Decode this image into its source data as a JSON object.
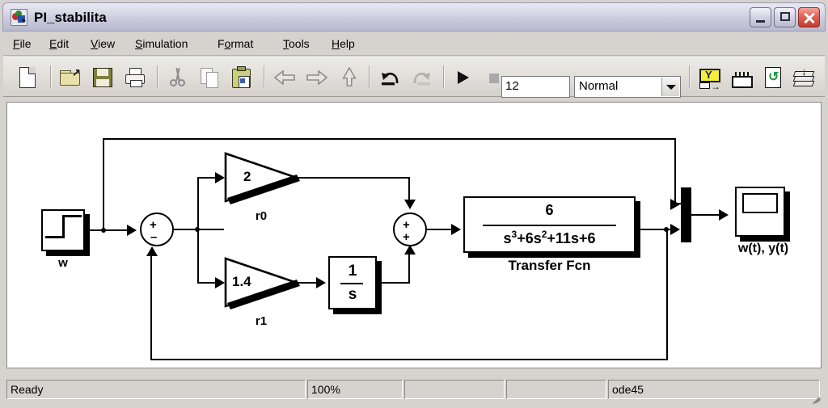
{
  "window": {
    "title": "PI_stabilita",
    "icon": "simulink-icon",
    "controls": {
      "minimize": "minimize-button",
      "maximize": "maximize-button",
      "close": "close-button"
    }
  },
  "menu": {
    "items": [
      {
        "label": "File",
        "accel": "F"
      },
      {
        "label": "Edit",
        "accel": "E"
      },
      {
        "label": "View",
        "accel": "V"
      },
      {
        "label": "Simulation",
        "accel": "S"
      },
      {
        "label": "Format",
        "accel": "o"
      },
      {
        "label": "Tools",
        "accel": "T"
      },
      {
        "label": "Help",
        "accel": "H"
      }
    ]
  },
  "toolbar": {
    "buttons": [
      {
        "name": "new-model-icon",
        "enabled": true
      },
      {
        "name": "open-model-icon",
        "enabled": true
      },
      {
        "name": "save-model-icon",
        "enabled": true
      },
      {
        "name": "print-model-icon",
        "enabled": true
      },
      {
        "name": "cut-icon",
        "enabled": false
      },
      {
        "name": "copy-icon",
        "enabled": false
      },
      {
        "name": "paste-icon",
        "enabled": true
      },
      {
        "name": "back-arrow-icon",
        "enabled": false
      },
      {
        "name": "forward-arrow-icon",
        "enabled": false
      },
      {
        "name": "up-arrow-icon",
        "enabled": false
      },
      {
        "name": "undo-icon",
        "enabled": true
      },
      {
        "name": "redo-icon",
        "enabled": false
      },
      {
        "name": "start-simulation-icon",
        "enabled": true
      },
      {
        "name": "stop-simulation-icon",
        "enabled": false
      },
      {
        "name": "library-browser-icon",
        "enabled": true
      },
      {
        "name": "model-explorer-icon",
        "enabled": true
      },
      {
        "name": "update-diagram-icon",
        "enabled": true
      },
      {
        "name": "build-model-icon",
        "enabled": true
      }
    ],
    "sim_stop_time": "12",
    "sim_mode": "Normal",
    "sim_mode_options": [
      "Normal"
    ]
  },
  "status_bar": {
    "message": "Ready",
    "zoom": "100%",
    "field3": "",
    "field4": "",
    "solver": "ode45"
  },
  "model": {
    "blocks": [
      {
        "id": "step",
        "type": "Step",
        "label": "w",
        "value": ""
      },
      {
        "id": "sum1",
        "type": "Sum",
        "label": "",
        "signs": [
          "+",
          "–"
        ]
      },
      {
        "id": "gain_r0",
        "type": "Gain",
        "label": "r0",
        "value": "2"
      },
      {
        "id": "gain_r1",
        "type": "Gain",
        "label": "r1",
        "value": "1.4"
      },
      {
        "id": "integrator",
        "type": "Integrator",
        "label": "",
        "numerator": "1",
        "denominator": "s"
      },
      {
        "id": "sum2",
        "type": "Sum",
        "label": "",
        "signs": [
          "+",
          "+"
        ]
      },
      {
        "id": "tf",
        "type": "Transfer Fcn",
        "label": "Transfer Fcn",
        "numerator": "6",
        "denominator_prefix": "s",
        "denominator": "+6s",
        "denominator_tail": "+11s+6",
        "exp1": "3",
        "exp2": "2"
      },
      {
        "id": "mux",
        "type": "Mux",
        "label": ""
      },
      {
        "id": "scope",
        "type": "Scope",
        "label": "w(t), y(t)"
      }
    ]
  },
  "colors": {
    "titlebar_start": "#e8e8f2",
    "titlebar_end": "#b9bacf",
    "window_face": "#d6d3ce",
    "canvas": "#ffffff",
    "close_button": "#c23b2e",
    "wire": "#000000"
  }
}
